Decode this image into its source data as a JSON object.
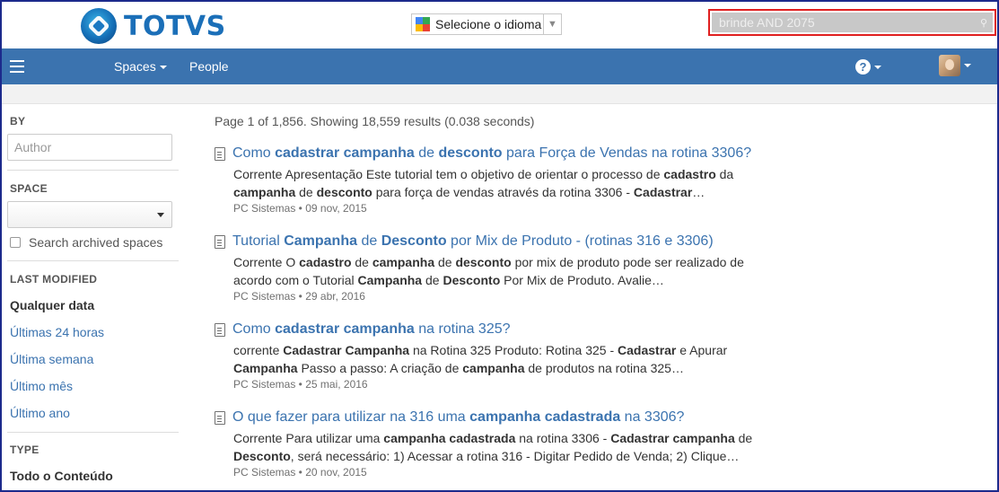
{
  "brand": {
    "name": "TOTVS"
  },
  "language": {
    "label": "Selecione o idioma"
  },
  "search": {
    "value": "brinde AND 2075"
  },
  "nav": {
    "spaces": "Spaces",
    "people": "People"
  },
  "sidebar": {
    "by_heading": "BY",
    "author_placeholder": "Author",
    "space_heading": "SPACE",
    "space_value": "",
    "archived_label": "Search archived spaces",
    "modified_heading": "LAST MODIFIED",
    "date_options": [
      "Qualquer data",
      "Últimas 24 horas",
      "Última semana",
      "Último mês",
      "Último ano"
    ],
    "type_heading": "TYPE",
    "type_all": "Todo o Conteúdo"
  },
  "results": {
    "summary": "Page 1 of 1,856. Showing 18,559 results (0.038 seconds)",
    "items": [
      {
        "title": [
          [
            "Como ",
            false
          ],
          [
            "cadastrar campanha",
            true
          ],
          [
            " de ",
            false
          ],
          [
            "desconto",
            true
          ],
          [
            " para Força de Vendas na rotina 3306?",
            false
          ]
        ],
        "line1": [
          [
            "Corrente Apresentação Este tutorial tem o objetivo de orientar o processo de ",
            false
          ],
          [
            "cadastro",
            true
          ],
          [
            " da",
            false
          ]
        ],
        "line2": [
          [
            "campanha",
            true
          ],
          [
            " de ",
            false
          ],
          [
            "desconto",
            true
          ],
          [
            " para força de vendas através da rotina 3306 - ",
            false
          ],
          [
            "Cadastrar",
            true
          ],
          [
            "…",
            false
          ]
        ],
        "meta": "PC Sistemas • 09 nov, 2015"
      },
      {
        "title": [
          [
            "Tutorial ",
            false
          ],
          [
            "Campanha",
            true
          ],
          [
            " de ",
            false
          ],
          [
            "Desconto",
            true
          ],
          [
            " por Mix de Produto - (rotinas 316 e 3306)",
            false
          ]
        ],
        "line1": [
          [
            "Corrente O ",
            false
          ],
          [
            "cadastro",
            true
          ],
          [
            " de ",
            false
          ],
          [
            "campanha",
            true
          ],
          [
            " de ",
            false
          ],
          [
            "desconto",
            true
          ],
          [
            " por mix de produto pode ser realizado de",
            false
          ]
        ],
        "line2": [
          [
            "acordo com o Tutorial ",
            false
          ],
          [
            "Campanha",
            true
          ],
          [
            " de ",
            false
          ],
          [
            "Desconto",
            true
          ],
          [
            " Por Mix de Produto. Avalie…",
            false
          ]
        ],
        "meta": "PC Sistemas • 29 abr, 2016"
      },
      {
        "title": [
          [
            "Como ",
            false
          ],
          [
            "cadastrar campanha",
            true
          ],
          [
            " na rotina 325?",
            false
          ]
        ],
        "line1": [
          [
            "corrente ",
            false
          ],
          [
            "Cadastrar Campanha",
            true
          ],
          [
            " na Rotina 325 Produto: Rotina 325 - ",
            false
          ],
          [
            "Cadastrar",
            true
          ],
          [
            " e Apurar",
            false
          ]
        ],
        "line2": [
          [
            "Campanha",
            true
          ],
          [
            " Passo a passo: A criação de ",
            false
          ],
          [
            "campanha",
            true
          ],
          [
            " de produtos na rotina 325…",
            false
          ]
        ],
        "meta": "PC Sistemas • 25 mai, 2016"
      },
      {
        "title": [
          [
            "O que fazer para utilizar na 316 uma ",
            false
          ],
          [
            "campanha cadastrada",
            true
          ],
          [
            " na 3306?",
            false
          ]
        ],
        "line1": [
          [
            "Corrente Para utilizar uma ",
            false
          ],
          [
            "campanha cadastrada",
            true
          ],
          [
            " na rotina 3306 - ",
            false
          ],
          [
            "Cadastrar campanha",
            true
          ],
          [
            " de",
            false
          ]
        ],
        "line2": [
          [
            "Desconto",
            true
          ],
          [
            ", será necessário: 1) Acessar a rotina 316 - Digitar Pedido de Venda; 2) Clique…",
            false
          ]
        ],
        "meta": "PC Sistemas • 20 nov, 2015"
      }
    ]
  }
}
